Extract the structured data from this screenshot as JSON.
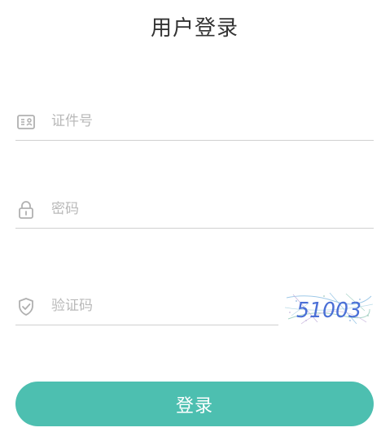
{
  "page": {
    "title": "用户登录"
  },
  "form": {
    "id_field": {
      "icon": "id-card-icon",
      "value": "",
      "placeholder": "证件号"
    },
    "password_field": {
      "icon": "lock-icon",
      "value": "",
      "placeholder": "密码"
    },
    "captcha_field": {
      "icon": "shield-check-icon",
      "value": "",
      "placeholder": "验证码"
    },
    "captcha_image": {
      "text": "51003"
    },
    "submit_label": "登录"
  },
  "colors": {
    "accent": "#4dbfb0",
    "icon": "#b0b0b0",
    "underline": "#d0d0d0",
    "captcha_text": "#4a6fd6"
  }
}
